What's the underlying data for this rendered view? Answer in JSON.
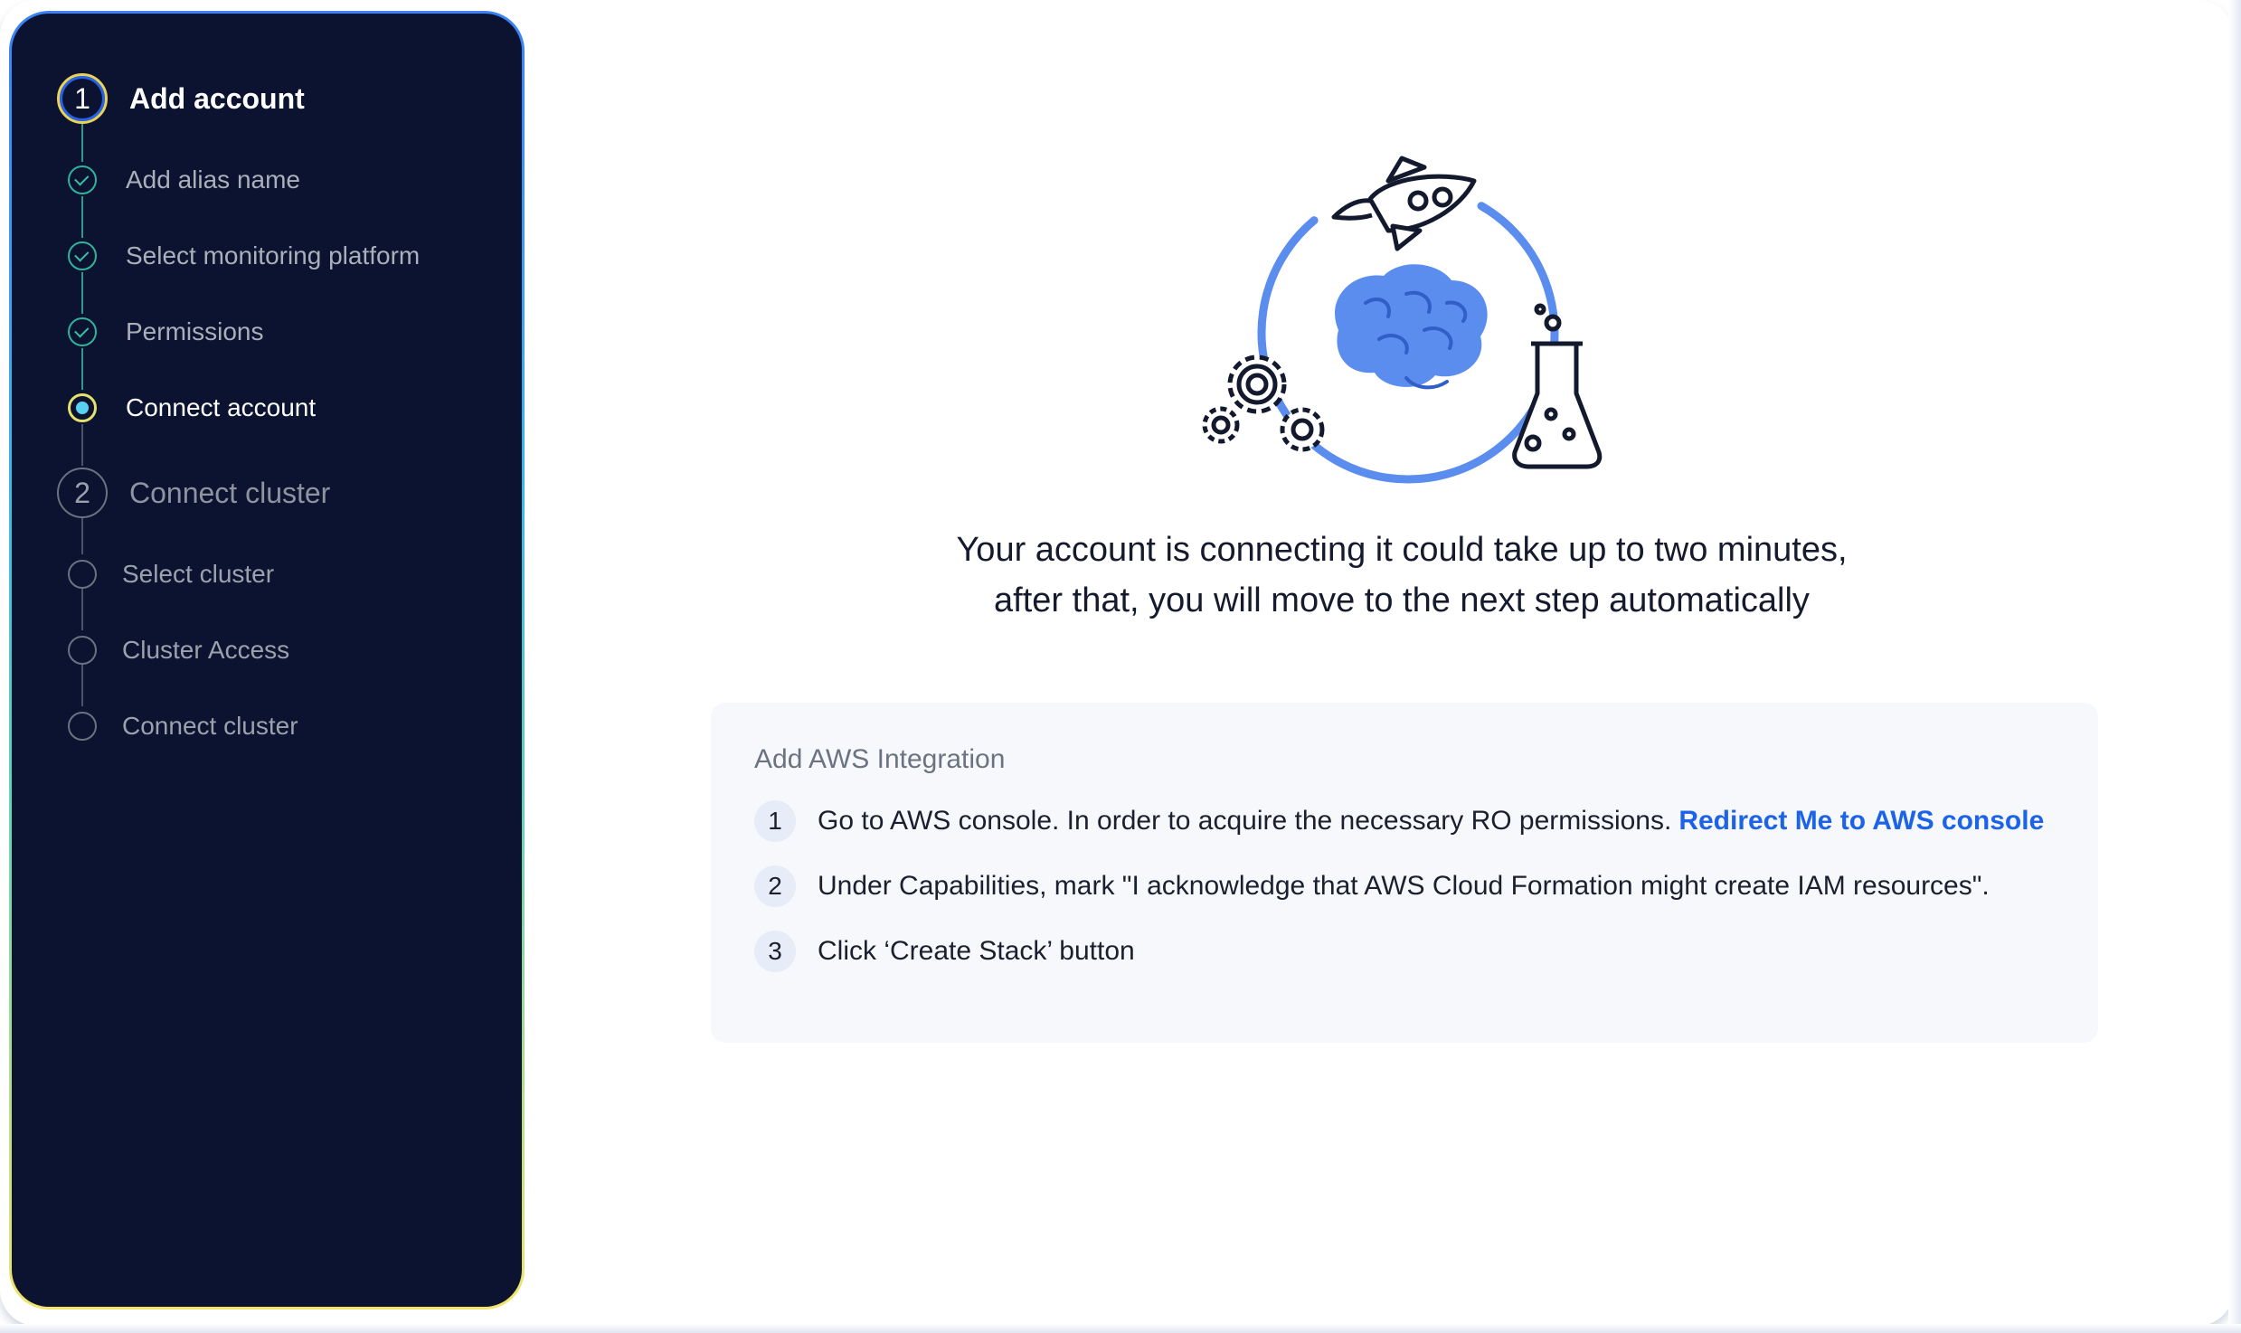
{
  "sidebar": {
    "steps": [
      {
        "number": "1",
        "label": "Add account",
        "state": "active",
        "substeps": [
          {
            "label": "Add alias name",
            "state": "done"
          },
          {
            "label": "Select monitoring platform",
            "state": "done"
          },
          {
            "label": "Permissions",
            "state": "done"
          },
          {
            "label": "Connect account",
            "state": "current"
          }
        ]
      },
      {
        "number": "2",
        "label": "Connect cluster",
        "state": "pending",
        "substeps": [
          {
            "label": "Select cluster",
            "state": "pending"
          },
          {
            "label": "Cluster Access",
            "state": "pending"
          },
          {
            "label": "Connect cluster",
            "state": "pending"
          }
        ]
      }
    ]
  },
  "main": {
    "message_line1": "Your account is connecting it could take up to two minutes,",
    "message_line2": "after that, you will move to the next step automatically",
    "card": {
      "title": "Add AWS Integration",
      "instructions": [
        {
          "number": "1",
          "text": "Go to AWS console. In order to acquire the necessary RO permissions.",
          "link": "Redirect Me to AWS console"
        },
        {
          "number": "2",
          "text": "Under Capabilities, mark \"I acknowledge that AWS Cloud Formation might create IAM resources\"."
        },
        {
          "number": "3",
          "text": "Click ‘Create Stack’ button"
        }
      ]
    }
  },
  "colors": {
    "sidebar_bg": "#0b1330",
    "accent_blue": "#1d63e8",
    "done_green": "#2fb39a",
    "illustration_blue": "#5b8def"
  }
}
